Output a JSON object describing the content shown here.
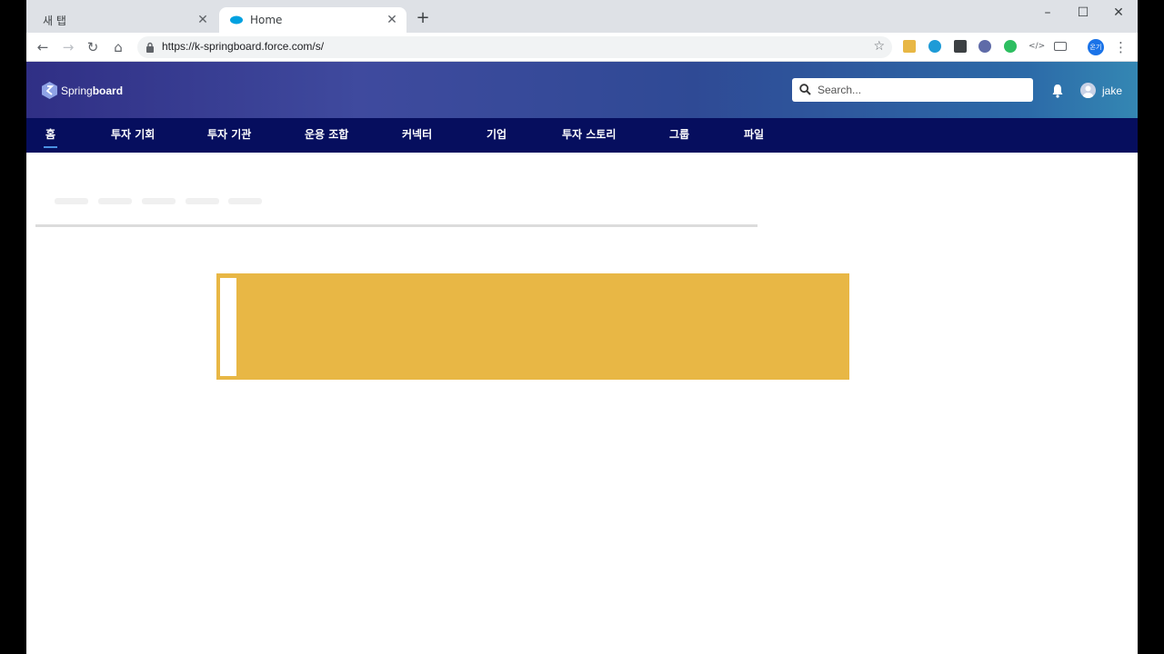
{
  "browser": {
    "tabs": [
      {
        "title": "새 탭",
        "active": false
      },
      {
        "title": "Home",
        "active": true
      }
    ],
    "url": "https://k-springboard.force.com/s/",
    "profile_label": "온기"
  },
  "header": {
    "logo_prefix": "Spring",
    "logo_suffix": "board",
    "search_placeholder": "Search...",
    "username": "jake"
  },
  "nav": {
    "items": [
      {
        "label": "홈",
        "active": true
      },
      {
        "label": "투자 기회"
      },
      {
        "label": "투자 기관"
      },
      {
        "label": "운용 조합"
      },
      {
        "label": "커넥터"
      },
      {
        "label": "기업"
      },
      {
        "label": "투자 스토리"
      },
      {
        "label": "그룹"
      },
      {
        "label": "파일"
      }
    ]
  },
  "colors": {
    "nav_bg": "#060e5e",
    "banner": "#e8b745",
    "active_underline": "#4a90e2"
  }
}
